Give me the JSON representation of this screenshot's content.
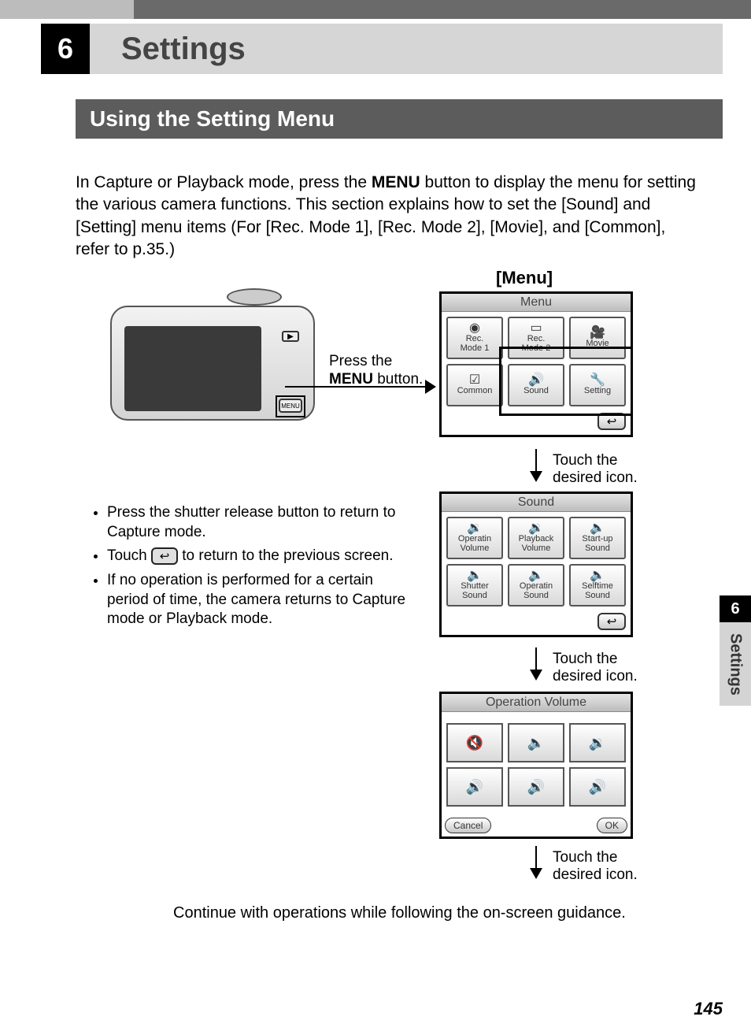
{
  "chapter": {
    "number": "6",
    "title": "Settings"
  },
  "section_title": "Using the Setting Menu",
  "intro": {
    "pre": "In Capture or Playback mode, press the ",
    "menu_word": "MENU",
    "post": " button to display the menu for setting the various camera functions. This section explains how to set the [Sound] and [Setting] menu items (For [Rec. Mode 1], [Rec. Mode 2], [Movie], and [Common], refer to p.35.)"
  },
  "menu_label": "[Menu]",
  "press_menu": {
    "line1": "Press the",
    "line2a": "MENU",
    "line2b": " button."
  },
  "touch_hint": {
    "line1": "Touch the",
    "line2": "desired icon."
  },
  "bullets": {
    "b1": "Press the shutter release button to return to Capture mode.",
    "b2a": "Touch ",
    "b2_icon": "↩",
    "b2b": " to return to the previous screen.",
    "b3": "If no operation is performed for a certain period of time, the camera returns to Capture mode or Playback mode."
  },
  "screen1": {
    "title": "Menu",
    "t1": {
      "icon": "◉",
      "l1": "Rec.",
      "l2": "Mode 1"
    },
    "t2": {
      "icon": "▭",
      "l1": "Rec.",
      "l2": "Mode 2"
    },
    "t3": {
      "icon": "🎥",
      "l1": "Movie",
      "l2": ""
    },
    "t4": {
      "icon": "☑",
      "l1": "Common",
      "l2": ""
    },
    "t5": {
      "icon": "🔊",
      "l1": "Sound",
      "l2": ""
    },
    "t6": {
      "icon": "🔧",
      "l1": "Setting",
      "l2": ""
    },
    "back": "↩"
  },
  "screen2": {
    "title": "Sound",
    "t1": {
      "icon": "🔉",
      "l1": "Operatin",
      "l2": "Volume"
    },
    "t2": {
      "icon": "🔉",
      "l1": "Playback",
      "l2": "Volume"
    },
    "t3": {
      "icon": "🔈",
      "l1": "Start-up",
      "l2": "Sound"
    },
    "t4": {
      "icon": "🔈",
      "l1": "Shutter",
      "l2": "Sound"
    },
    "t5": {
      "icon": "🔈",
      "l1": "Operatin",
      "l2": "Sound"
    },
    "t6": {
      "icon": "🔈",
      "l1": "Selftime",
      "l2": "Sound"
    },
    "back": "↩"
  },
  "screen3": {
    "title": "Operation Volume",
    "v1": "🔇",
    "v2": "🔈",
    "v3": "🔉",
    "v4": "🔊",
    "v5": "🔊",
    "v6": "🔊",
    "cancel": "Cancel",
    "ok": "OK"
  },
  "continue_text": "Continue with operations while following the on-screen guidance.",
  "side": {
    "number": "6",
    "label": "Settings"
  },
  "page_number": "145",
  "camera": {
    "menu_btn": "MENU",
    "play": "▶"
  }
}
